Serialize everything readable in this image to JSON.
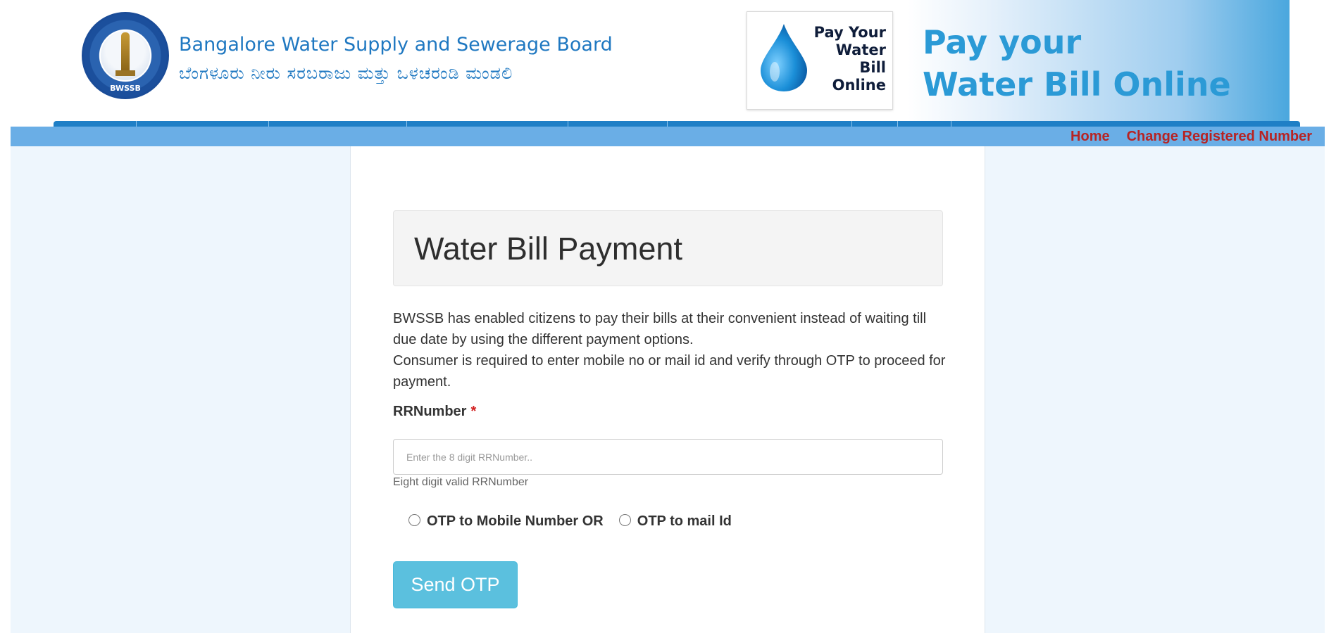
{
  "header": {
    "seal_text": "BWSSB",
    "org_name_en": "Bangalore Water Supply and Sewerage Board",
    "org_name_kn": "ಬೆಂಗಳೂರು ನೀರು ಸರಬರಾಜು ಮತ್ತು ಒಳಚರಂಡಿ ಮಂಡಲಿ",
    "banner_card_text": "Pay Your Water Bill Online",
    "banner_card_lines": [
      "Pay Your",
      "Water",
      "Bill",
      "Online"
    ],
    "banner_headline_lines": [
      "Pay your",
      "Water Bill Online"
    ]
  },
  "nav": {
    "links": [
      {
        "label": "Home"
      },
      {
        "label": "Change Registered Number"
      }
    ]
  },
  "main": {
    "title": "Water Bill Payment",
    "description_line1": "BWSSB has enabled citizens to pay their bills at their convenient instead of waiting till due date by using the different payment options.",
    "description_line2": "Consumer is required to enter mobile no or mail id and verify through OTP to proceed for payment.",
    "rr_label": "RRNumber",
    "rr_required_mark": "*",
    "rr_placeholder": "Enter the 8 digit RRNumber..",
    "rr_value": "",
    "rr_help": "Eight digit valid RRNumber",
    "otp_options": [
      {
        "label": "OTP to Mobile Number OR",
        "checked": false
      },
      {
        "label": "OTP to mail Id",
        "checked": false
      }
    ],
    "send_button": "Send OTP"
  },
  "colors": {
    "nav_bar": "#6aaee6",
    "nav_link": "#b72323",
    "side_panels": "#eef6fd",
    "button": "#5bc0de",
    "brand_blue": "#1f78c1"
  }
}
